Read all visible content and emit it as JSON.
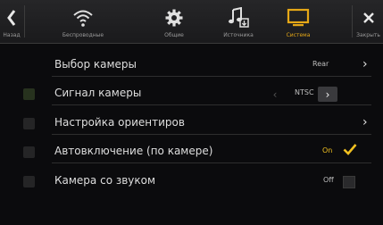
{
  "nav": {
    "back_label": "Назад",
    "tabs": [
      {
        "label": "Беспроводные",
        "icon": "wireless-icon"
      },
      {
        "label": "Общие",
        "icon": "gear-icon"
      },
      {
        "label": "Источника",
        "icon": "music-note-icon"
      },
      {
        "label": "Система",
        "icon": "display-icon"
      }
    ],
    "close_label": "Закрыть",
    "accent": "#e6a817"
  },
  "settings": [
    {
      "label": "Выбор камеры",
      "value": "Rear"
    },
    {
      "label": "Сигнал камеры",
      "value": "NTSC"
    },
    {
      "label": "Настройка ориентиров"
    },
    {
      "label": "Автовключение (по камере)",
      "value": "On",
      "checked": true
    },
    {
      "label": "Камера со звуком",
      "value": "Off",
      "checked": false
    }
  ]
}
